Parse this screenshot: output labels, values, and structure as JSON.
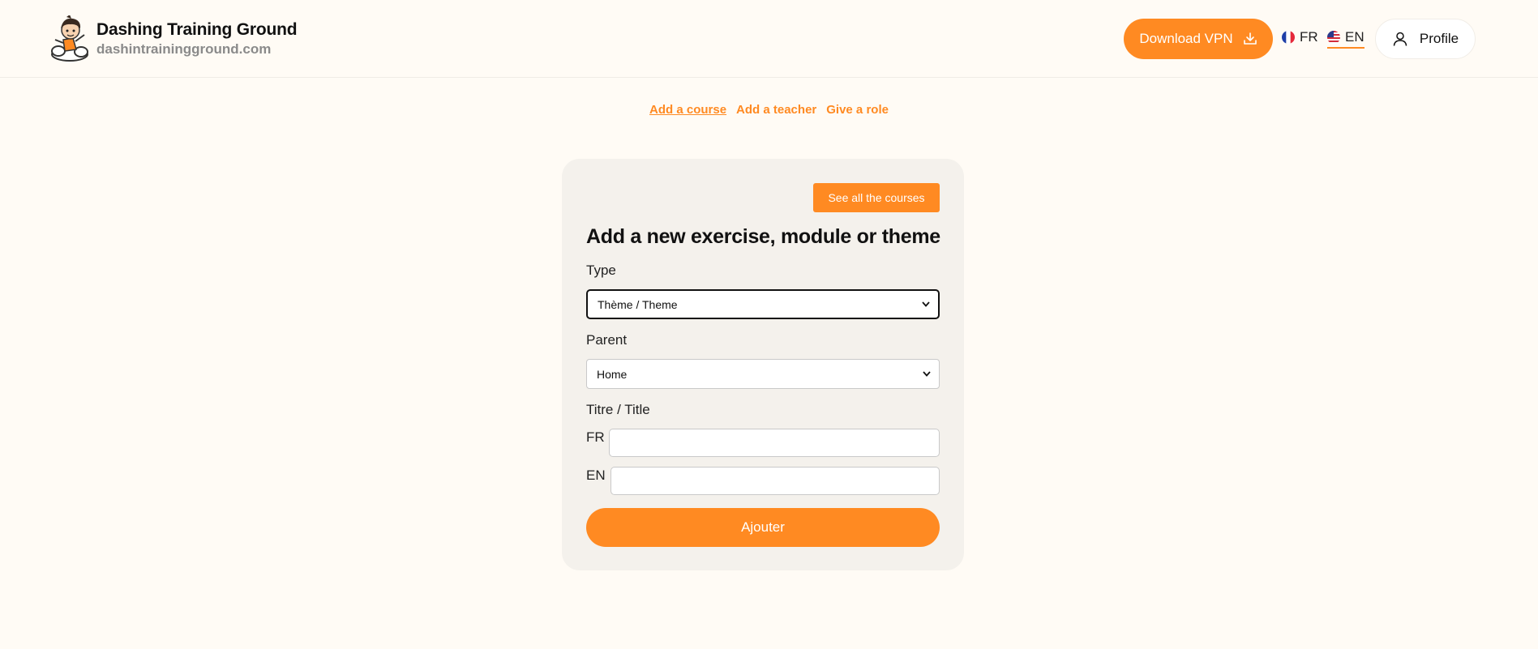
{
  "site": {
    "title": "Dashing Training Ground",
    "domain": "dashintrainingground.com"
  },
  "header": {
    "download_vpn": "Download VPN",
    "lang_fr": "FR",
    "lang_en": "EN",
    "active_lang": "EN",
    "profile": "Profile"
  },
  "subnav": {
    "items": [
      {
        "label": "Add a course",
        "active": true
      },
      {
        "label": "Add a teacher",
        "active": false
      },
      {
        "label": "Give a role",
        "active": false
      }
    ]
  },
  "form": {
    "see_all": "See all the courses",
    "title": "Add a new exercise, module or theme",
    "type_label": "Type",
    "type_value": "Thème / Theme",
    "parent_label": "Parent",
    "parent_value": "Home",
    "title_label": "Titre / Title",
    "fr_label": "FR",
    "en_label": "EN",
    "fr_value": "",
    "en_value": "",
    "submit": "Ajouter"
  },
  "colors": {
    "accent": "#ff8a22",
    "background": "#fffbf5",
    "card": "#f4f1ec"
  }
}
